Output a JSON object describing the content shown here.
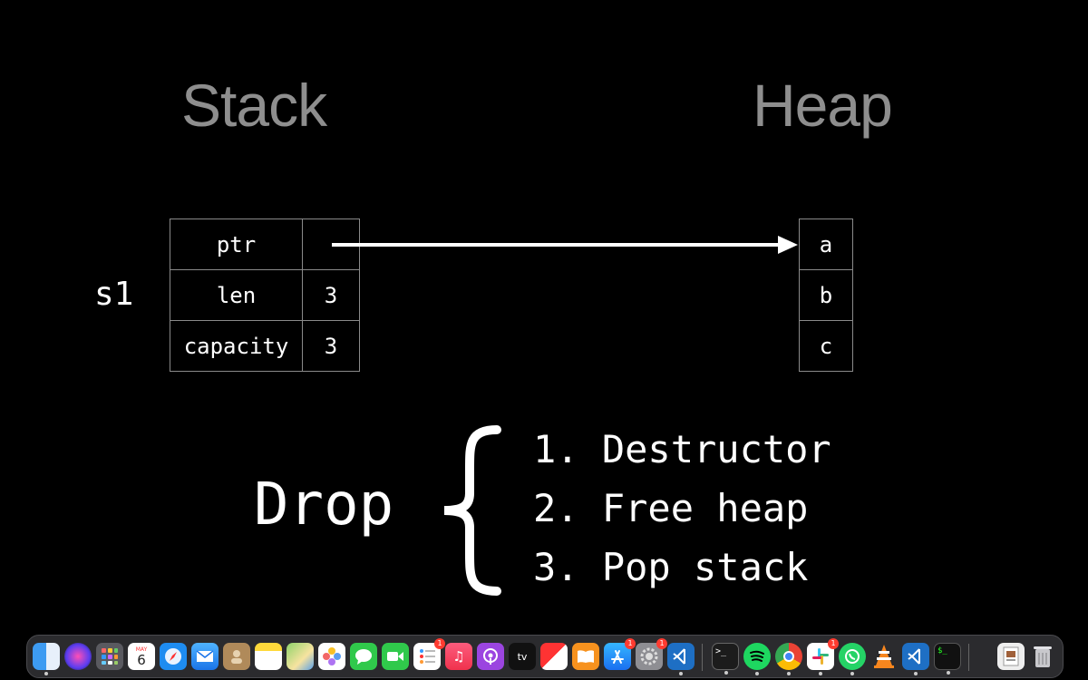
{
  "headings": {
    "stack": "Stack",
    "heap": "Heap"
  },
  "variable": "s1",
  "stack_rows": [
    {
      "field": "ptr",
      "value": ""
    },
    {
      "field": "len",
      "value": "3"
    },
    {
      "field": "capacity",
      "value": "3"
    }
  ],
  "heap_cells": [
    "a",
    "b",
    "c"
  ],
  "drop": {
    "word": "Drop",
    "steps": [
      "1. Destructor",
      "2. Free heap",
      "3. Pop stack"
    ]
  },
  "dock": {
    "calendar": {
      "month": "MAY",
      "day": "6"
    },
    "badges": {
      "reminders": "1",
      "appstore": "1",
      "settings": "1",
      "slack": "1"
    },
    "appletv_label": "tv",
    "apps": [
      "finder-icon",
      "siri-icon",
      "launchpad-icon",
      "calendar-icon",
      "safari-icon",
      "mail-icon",
      "contacts-icon",
      "notes-icon",
      "maps-icon",
      "photos-icon",
      "messages-icon",
      "facetime-icon",
      "reminders-icon",
      "music-icon",
      "podcasts-icon",
      "appletv-icon",
      "news-icon",
      "books-icon",
      "appstore-icon",
      "settings-icon",
      "vscode-icon",
      "terminal-icon",
      "spotify-icon",
      "chrome-icon",
      "slack-icon",
      "whatsapp-icon",
      "vlc-icon",
      "vscode-insiders-icon",
      "iterm-icon",
      "preview-icon",
      "trash-icon"
    ]
  },
  "colors": {
    "background": "#000000",
    "heading": "#8e8e8e",
    "grid": "#8a8a8a",
    "text": "#ffffff"
  }
}
